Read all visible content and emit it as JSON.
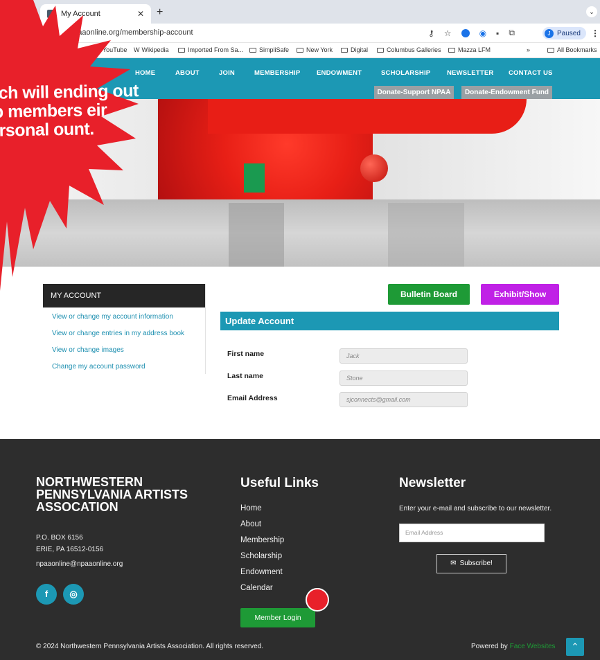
{
  "browser": {
    "tab_title": "My Account",
    "url": "npaaonline.org/membership-account",
    "profile_label": "Paused",
    "profile_initial": "J",
    "bookmarks": [
      "YouTube",
      "Wikipedia",
      "Imported From Sa...",
      "SimpliSafe",
      "New York",
      "Digital",
      "Columbus Galleries",
      "Mazza LFM"
    ],
    "all_bookmarks": "All Bookmarks",
    "overflow": "»"
  },
  "nav": {
    "items": [
      "HOME",
      "ABOUT",
      "JOIN",
      "MEMBERSHIP",
      "ENDOWMENT",
      "SCHOLARSHIP",
      "NEWSLETTER",
      "CONTACT US"
    ],
    "donate_support": "Donate-Support NPAA",
    "donate_endowment": "Donate-Endowment Fund"
  },
  "sidebar": {
    "heading": "MY ACCOUNT",
    "links": [
      "View or change my account information",
      "View or change entries in my address book",
      "View or change images",
      "Change my account password"
    ]
  },
  "main": {
    "bulletin_board": "Bulletin Board",
    "exhibit_show": "Exhibit/Show",
    "section_title": "Update Account",
    "fields": [
      {
        "label": "First name",
        "value": "Jack"
      },
      {
        "label": "Last name",
        "value": "Stone"
      },
      {
        "label": "Email Address",
        "value": "sjconnects@gmail.com"
      }
    ]
  },
  "footer": {
    "org_name": "NORTHWESTERN PENNSYLVANIA ARTISTS ASSOCATION",
    "po_box": "P.O. BOX 6156",
    "city": "ERIE, PA 16512-0156",
    "email": "npaaonline@npaaonline.org",
    "useful_links_title": "Useful Links",
    "useful_links": [
      "Home",
      "About",
      "Membership",
      "Scholarship",
      "Endowment",
      "Calendar"
    ],
    "member_login": "Member Login",
    "newsletter_title": "Newsletter",
    "newsletter_text": "Enter your e-mail and subscribe to our newsletter.",
    "email_placeholder": "Email Address",
    "subscribe": "Subscribe!",
    "copyright": "© 2024 Northwestern Pennsylvania Artists Association. All rights reserved.",
    "powered_by": "Powered by",
    "powered_by_link": "Face Websites"
  },
  "callout": {
    "text": "oach will ending out elp members eir personal ount."
  },
  "colors": {
    "brand_teal": "#1c98b4",
    "green_button": "#1e9a36",
    "purple_button": "#c021e6",
    "callout_red": "#e8202a"
  }
}
